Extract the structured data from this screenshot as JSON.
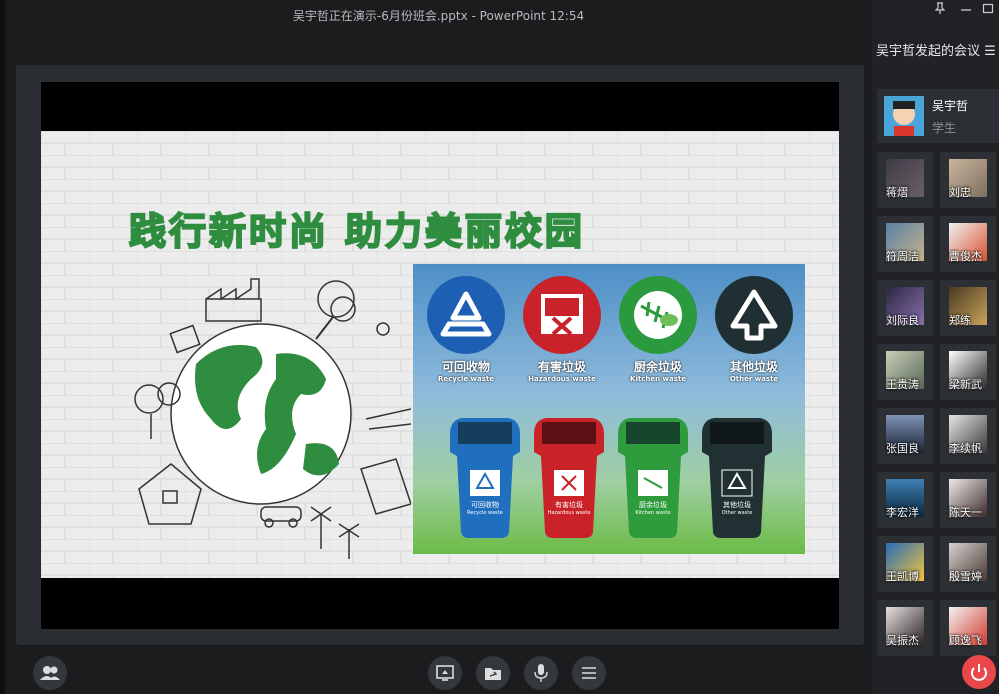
{
  "window": {
    "title": "吴宇哲正在演示-6月份班会.pptx - PowerPoint 12:54"
  },
  "slide": {
    "title": "践行新时尚 助力美丽校园",
    "categories": [
      {
        "cn": "可回收物",
        "en": "Recycle waste",
        "color": "#1d5fb2",
        "icon": "recycle-icon"
      },
      {
        "cn": "有害垃圾",
        "en": "Hazardous waste",
        "color": "#c8232a",
        "icon": "hazard-icon"
      },
      {
        "cn": "厨余垃圾",
        "en": "Kitchen waste",
        "color": "#2b9a3e",
        "icon": "fishbone-icon"
      },
      {
        "cn": "其他垃圾",
        "en": "Other waste",
        "color": "#1f2f33",
        "icon": "triangle-icon"
      }
    ],
    "bins": [
      {
        "cn": "可回收物",
        "en": "Recycle waste",
        "color": "#1f6fbe"
      },
      {
        "cn": "有害垃圾",
        "en": "Hazardous waste",
        "color": "#c92228"
      },
      {
        "cn": "厨余垃圾",
        "en": "Kitchen waste",
        "color": "#2e9b3d"
      },
      {
        "cn": "其他垃圾",
        "en": "Other waste",
        "color": "#213033"
      }
    ]
  },
  "meeting": {
    "title": "吴宇哲发起的会议",
    "host": {
      "name": "吴宇哲",
      "role": "学生"
    },
    "participants": [
      "蒋熠",
      "刘忠",
      "符周洁",
      "曹俊杰",
      "刘际良",
      "郑练",
      "王贵涛",
      "梁新武",
      "张国良",
      "李续帆",
      "李宏洋",
      "陈天一",
      "王凯博",
      "殷雪婷",
      "吴振杰",
      "顾逸飞"
    ]
  },
  "colors": {
    "background": "#1b1c1e",
    "panel": "#2a2d31",
    "hangup": "#e9474a",
    "title_green": "#2f8d3f"
  }
}
